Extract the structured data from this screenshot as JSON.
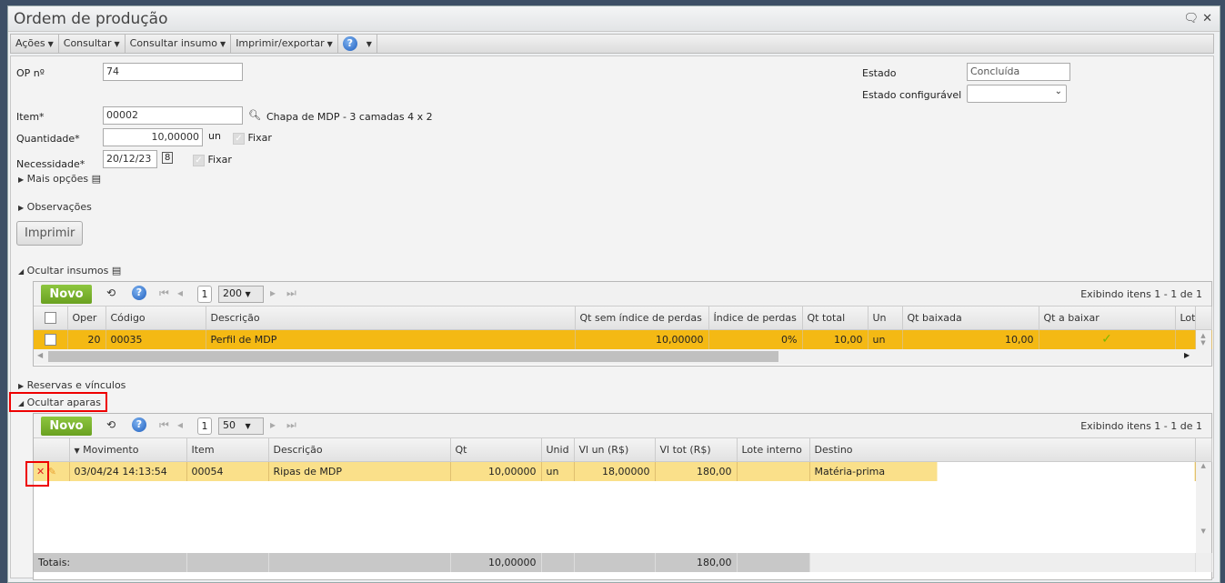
{
  "window": {
    "title": "Ordem de produção"
  },
  "menu": [
    {
      "label": "Ações"
    },
    {
      "label": "Consultar"
    },
    {
      "label": "Consultar insumo"
    },
    {
      "label": "Imprimir/exportar"
    }
  ],
  "form": {
    "op_label": "OP nº",
    "op_value": "74",
    "estado_label": "Estado",
    "estado_value": "Concluída",
    "estado_conf_label": "Estado configurável",
    "estado_conf_value": "",
    "item_label": "Item*",
    "item_value": "00002",
    "item_desc": "Chapa de MDP - 3 camadas 4 x 2",
    "qtd_label": "Quantidade*",
    "qtd_value": "10,00000",
    "qtd_unit": "un",
    "fixar": "Fixar",
    "nec_label": "Necessidade*",
    "nec_value": "20/12/23",
    "mais_opcoes": "Mais opções",
    "observacoes": "Observações",
    "imprimir": "Imprimir"
  },
  "insumos": {
    "section": "Ocultar insumos",
    "novo": "Novo",
    "page": "1",
    "page_size": "200",
    "showing": "Exibindo itens 1 - 1 de 1",
    "columns": [
      "Oper",
      "Código",
      "Descrição",
      "Qt sem índice de perdas",
      "Índice de perdas",
      "Qt total",
      "Un",
      "Qt baixada",
      "Qt a baixar",
      "Lot"
    ],
    "rows": [
      {
        "oper": "20",
        "codigo": "00035",
        "descricao": "Perfil de MDP",
        "qt_sem": "10,00000",
        "indice": "0%",
        "qt_total": "10,00",
        "un": "un",
        "qt_baixada": "10,00",
        "qt_a_baixar": "✓"
      }
    ]
  },
  "reservas": "Reservas e vínculos",
  "aparas": {
    "section": "Ocultar aparas",
    "novo": "Novo",
    "page": "1",
    "page_size": "50",
    "showing": "Exibindo itens 1 - 1 de 1",
    "columns": [
      "Movimento",
      "Item",
      "Descrição",
      "Qt",
      "Unid",
      "Vl un (R$)",
      "Vl tot (R$)",
      "Lote interno",
      "Destino"
    ],
    "rows": [
      {
        "movimento": "03/04/24 14:13:54",
        "item": "00054",
        "descricao": "Ripas de MDP",
        "qt": "10,00000",
        "unid": "un",
        "vl_un": "18,00000",
        "vl_tot": "180,00",
        "lote": "",
        "destino": "Matéria-prima"
      }
    ],
    "totals": {
      "label": "Totais:",
      "qt": "10,00000",
      "vl_tot": "180,00"
    }
  }
}
